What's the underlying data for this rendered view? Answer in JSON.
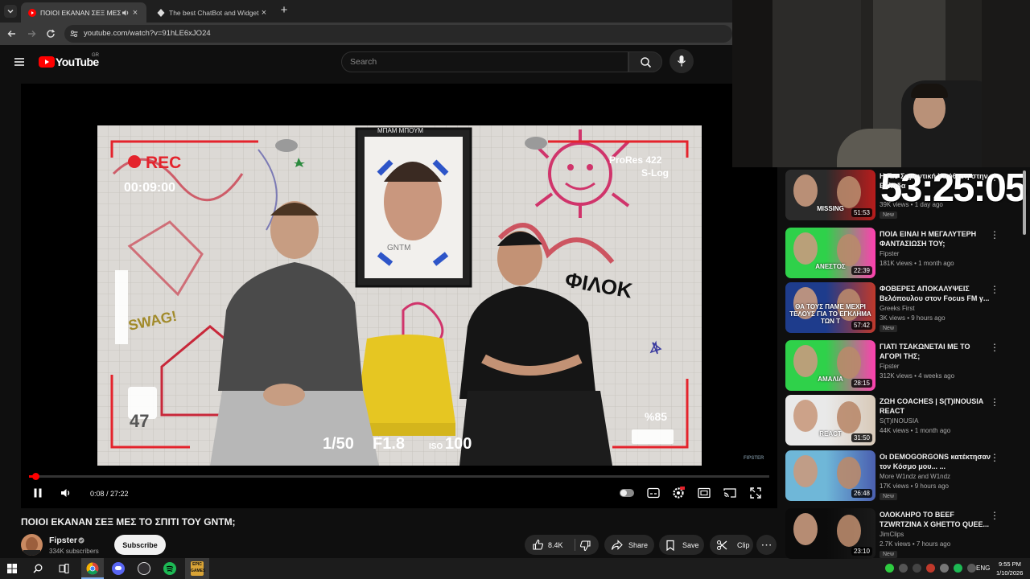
{
  "browser": {
    "tabs": [
      {
        "title": "ΠΟΙΟΙ ΕΚΑΝΑΝ ΣΕΞ ΜΕΣ ΤΟ",
        "active": true
      },
      {
        "title": "The best ChatBot and Widgets f",
        "active": false
      }
    ],
    "url": "youtube.com/watch?v=91hLE6xJO24"
  },
  "youtube": {
    "logo_text": "YouTube",
    "region": "GR",
    "search_placeholder": "Search"
  },
  "video_overlay": {
    "rec_label": "REC",
    "timecode": "00:09:00",
    "format_line1": "ProRes 422",
    "format_line2": "S-Log",
    "card_number": "47",
    "shutter": "1/50",
    "aperture": "F1.8",
    "iso_label": "ISO",
    "iso_value": "100",
    "battery": "%85",
    "watermark": "FIPSTER",
    "poster_text": "ΜΠΑΜ ΜΠΟΥΜ",
    "wall_text_1": "ΦΙΛΟΚ",
    "wall_text_2": "SWAG!"
  },
  "player": {
    "time": "0:08 / 27:22",
    "progress_fraction": 0.005
  },
  "video": {
    "title": "ΠΟΙΟΙ ΕΚΑΝΑΝ ΣΕΞ ΜΕΣ ΤΟ ΣΠΙΤΙ ΤΟΥ GNTM;",
    "channel": "Fipster",
    "subscribers": "334K subscribers",
    "subscribe_label": "Subscribe",
    "likes": "8.4K",
    "share_label": "Share",
    "save_label": "Save",
    "clip_label": "Clip"
  },
  "stream_timer": "53:25:05",
  "sidebar": [
    {
      "title": "Η Πιο Σημαντική Υπόθεση στην Ελλάδα",
      "channel": "",
      "meta": "39K views • 1 day ago",
      "duration": "51:53",
      "new": true,
      "thumb_text": "MISSING",
      "colors": [
        "#2b2b2b",
        "#b81c1c"
      ]
    },
    {
      "title": "ΠΟΙΑ ΕΙΝΑΙ Η ΜΕΓΑΛΥΤΕΡΗ ΦΑΝΤΑΣΙΩΣΗ ΤΟΥ;",
      "channel": "Fipster",
      "meta": "181K views • 1 month ago",
      "duration": "22:39",
      "new": false,
      "thumb_text": "ΑΝΕΣΤΟΣ",
      "colors": [
        "#2fd14a",
        "#ff3fb0"
      ]
    },
    {
      "title": "ΦΟΒΕΡΕΣ ΑΠΟΚΑΛΥΨΕΙΣ Βελόπουλου στον Focus FM γ...",
      "channel": "Greeks First",
      "meta": "3K views • 9 hours ago",
      "duration": "57:42",
      "new": true,
      "thumb_text": "ΘΑ ΤΟΥΣ ΠΑΜΕ ΜΕΧΡΙ ΤΕΛΟΥΣ ΓΙΑ ΤΟ ΕΓΚΛΗΜΑ ΤΩΝ Τ",
      "colors": [
        "#1e3c8c",
        "#c0392b"
      ]
    },
    {
      "title": "ΓΙΑΤΙ ΤΣΑΚΩΝΕΤΑΙ ΜΕ ΤΟ ΑΓΟΡΙ ΤΗΣ;",
      "channel": "Fipster",
      "meta": "312K views • 4 weeks ago",
      "duration": "28:15",
      "new": false,
      "thumb_text": "ΑΜΑΛΙΑ",
      "colors": [
        "#2fd14a",
        "#ff3fb0"
      ]
    },
    {
      "title": "ΖΩΗ COACHES | S(T)INOUSIA REACT",
      "channel": "S(T)INOUSIA",
      "meta": "44K views • 1 month ago",
      "duration": "31:50",
      "new": false,
      "thumb_text": "REACT",
      "colors": [
        "#e9e9e9",
        "#d8c9b8"
      ]
    },
    {
      "title": "Οι DEMOGORGONS κατέκτησαν τον Κόσμο μου... ...",
      "channel": "More W1ndz and W1ndz",
      "meta": "17K views • 9 hours ago",
      "duration": "26:48",
      "new": true,
      "thumb_text": "",
      "colors": [
        "#6fb7d8",
        "#4a5fb0"
      ]
    },
    {
      "title": "ΟΛΟΚΛΗΡΟ ΤΟ BEEF TZWRTZINA X GHETTO QUEE...",
      "channel": "JimClips",
      "meta": "2.7K views • 7 hours ago",
      "duration": "23:10",
      "new": true,
      "thumb_text": "",
      "colors": [
        "#0b0b0b",
        "#1a1a1a"
      ]
    }
  ],
  "taskbar": {
    "language": "ENG",
    "time": "9:55 PM",
    "date": "1/10/2026"
  },
  "colors": {
    "youtube_red": "#ff0000",
    "rec_red": "#e4232c"
  },
  "icons": [
    "chevron-down-icon",
    "speaker-icon",
    "close-icon",
    "plus-icon",
    "back-icon",
    "forward-icon",
    "reload-icon",
    "site-info-icon",
    "menu-icon",
    "search-icon",
    "mic-icon",
    "pause-icon",
    "volume-icon",
    "autoplay-toggle-icon",
    "captions-icon",
    "settings-icon",
    "miniplayer-icon",
    "cast-icon",
    "fullscreen-icon",
    "like-icon",
    "dislike-icon",
    "share-icon",
    "save-icon",
    "clip-icon",
    "more-icon",
    "verified-icon",
    "windows-start-icon",
    "taskbar-search-icon",
    "task-view-icon",
    "chrome-icon",
    "discord-icon",
    "obs-icon",
    "spotify-icon",
    "epic-games-icon"
  ]
}
